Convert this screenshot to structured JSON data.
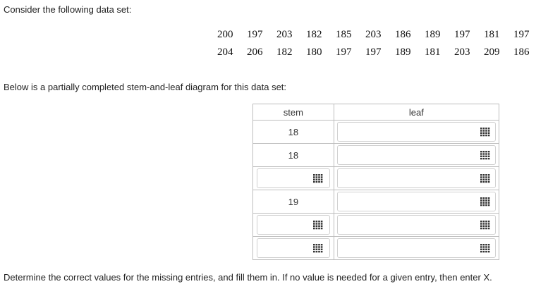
{
  "intro_text": "Consider the following data set:",
  "dataset": {
    "row1": [
      "200",
      "197",
      "203",
      "182",
      "185",
      "203",
      "186",
      "189",
      "197",
      "181",
      "197"
    ],
    "row2": [
      "204",
      "206",
      "182",
      "180",
      "197",
      "197",
      "189",
      "181",
      "203",
      "209",
      "186"
    ]
  },
  "below_text": "Below is a partially completed stem-and-leaf diagram for this data set:",
  "table": {
    "stem_header": "stem",
    "leaf_header": "leaf",
    "rows": [
      {
        "stem": "18",
        "stem_input": false
      },
      {
        "stem": "18",
        "stem_input": false
      },
      {
        "stem": "",
        "stem_input": true
      },
      {
        "stem": "19",
        "stem_input": false
      },
      {
        "stem": "",
        "stem_input": true
      },
      {
        "stem": "",
        "stem_input": true
      }
    ]
  },
  "footer_text": "Determine the correct values for the missing entries, and fill them in. If no value is needed for a given entry, then enter X.",
  "colors": {
    "border": "#bdbdbd",
    "icon": "#333333"
  },
  "icon_name": "keypad-icon"
}
